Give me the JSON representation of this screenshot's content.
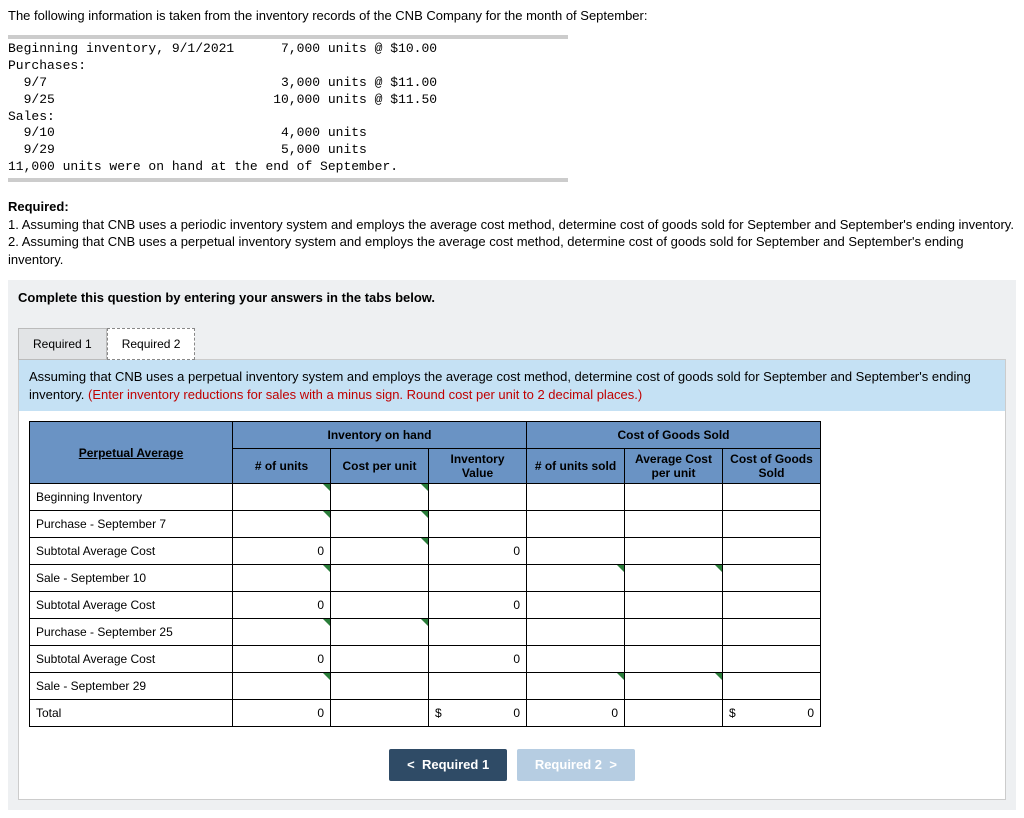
{
  "intro": "The following information is taken from the inventory records of the CNB Company for the month of September:",
  "mono": "Beginning inventory, 9/1/2021      7,000 units @ $10.00\nPurchases:\n  9/7                              3,000 units @ $11.00\n  9/25                            10,000 units @ $11.50\nSales:\n  9/10                             4,000 units\n  9/29                             5,000 units\n11,000 units were on hand at the end of September.",
  "required": {
    "heading": "Required:",
    "r1": "1. Assuming that CNB uses a periodic inventory system and employs the average cost method, determine cost of goods sold for September and September's ending inventory.",
    "r2": "2. Assuming that CNB uses a perpetual inventory system and employs the average cost method, determine cost of goods sold for September and September's ending inventory."
  },
  "panel": {
    "instruction": "Complete this question by entering your answers in the tabs below.",
    "tab1": "Required 1",
    "tab2": "Required 2",
    "banner_main": "Assuming that CNB uses a perpetual inventory system and employs the average cost method, determine cost of goods sold for September and September's ending inventory. ",
    "banner_red": "(Enter inventory reductions for sales with a minus sign. Round cost per unit to 2 decimal places.)"
  },
  "table": {
    "title": "Perpetual Average",
    "group1": "Inventory on hand",
    "group2": "Cost of Goods Sold",
    "h_units": "# of units",
    "h_cost": "Cost per unit",
    "h_inv": "Inventory Value",
    "h_unitsold": "# of units sold",
    "h_avg": "Average Cost per unit",
    "h_cogs": "Cost of Goods Sold",
    "rows": [
      "Beginning Inventory",
      "Purchase - September 7",
      "Subtotal Average Cost",
      "Sale - September 10",
      "Subtotal Average Cost",
      "Purchase - September 25",
      "Subtotal Average Cost",
      "Sale - September 29",
      "Total"
    ],
    "zero": "0",
    "currency": "$"
  },
  "nav": {
    "prev": "Required 1",
    "next": "Required 2",
    "lchev": "<",
    "rchev": ">"
  }
}
